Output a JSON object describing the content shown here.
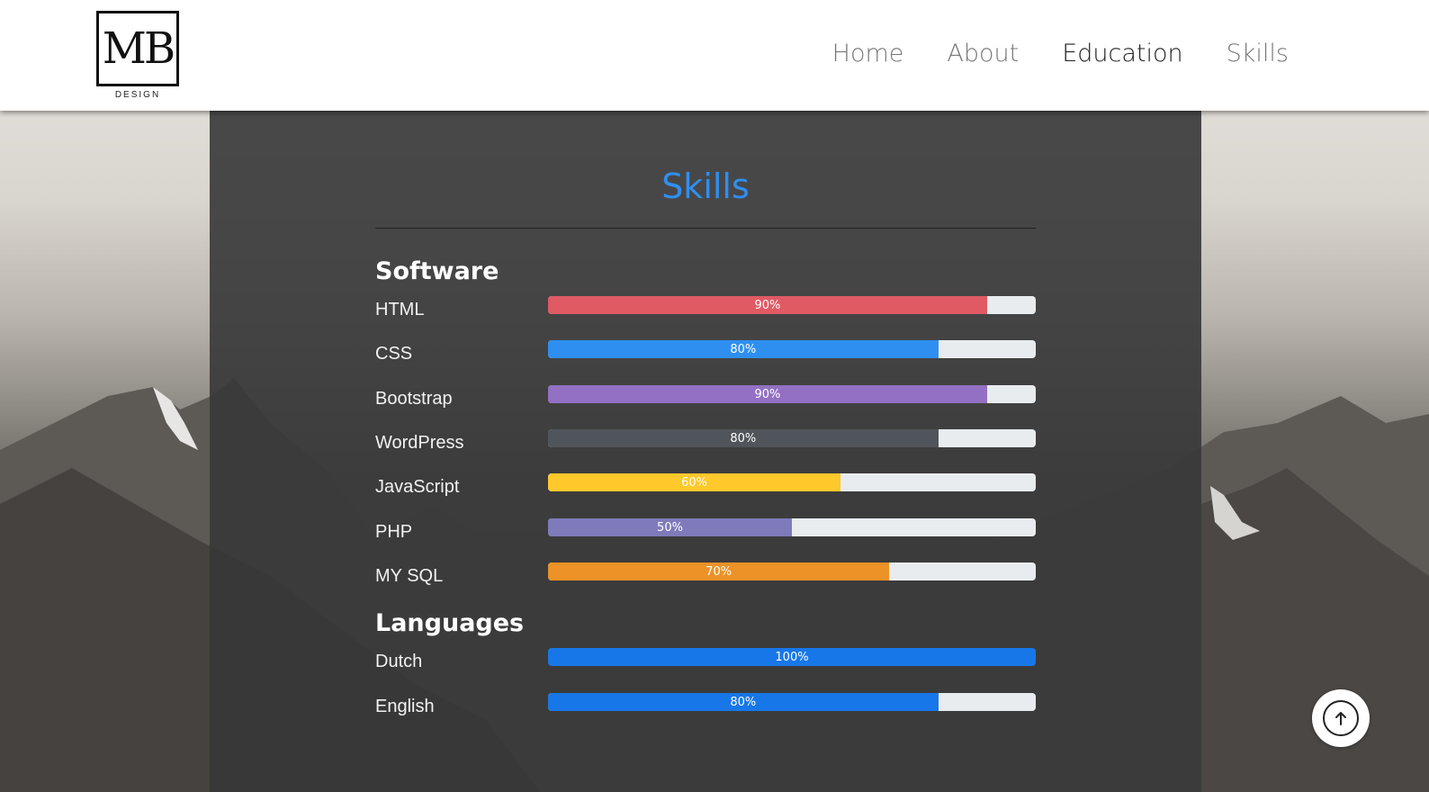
{
  "brand": {
    "logo_text": "MB",
    "logo_sub": "DESIGN"
  },
  "nav": {
    "items": [
      {
        "label": "Home",
        "active": false
      },
      {
        "label": "About",
        "active": false
      },
      {
        "label": "Education",
        "active": true
      },
      {
        "label": "Skills",
        "active": false
      }
    ]
  },
  "skills": {
    "title": "Skills",
    "software": {
      "heading": "Software",
      "items": [
        {
          "name": "HTML",
          "percent": 90,
          "label": "90%",
          "color": "#e05a64"
        },
        {
          "name": "CSS",
          "percent": 80,
          "label": "80%",
          "color": "#2f8ff0"
        },
        {
          "name": "Bootstrap",
          "percent": 90,
          "label": "90%",
          "color": "#9370c3"
        },
        {
          "name": "WordPress",
          "percent": 80,
          "label": "80%",
          "color": "#50555b"
        },
        {
          "name": "JavaScript",
          "percent": 60,
          "label": "60%",
          "color": "#ffc82b"
        },
        {
          "name": "PHP",
          "percent": 50,
          "label": "50%",
          "color": "#7f7bba"
        },
        {
          "name": "MY SQL",
          "percent": 70,
          "label": "70%",
          "color": "#ec9227"
        }
      ]
    },
    "languages": {
      "heading": "Languages",
      "items": [
        {
          "name": "Dutch",
          "percent": 100,
          "label": "100%",
          "color": "#1877e8"
        },
        {
          "name": "English",
          "percent": 80,
          "label": "80%",
          "color": "#1877e8"
        }
      ]
    }
  },
  "icons": {
    "back_to_top": "arrow-up-icon"
  }
}
